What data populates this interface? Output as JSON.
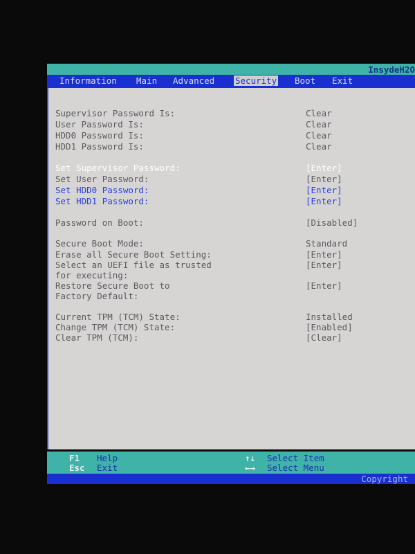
{
  "header": {
    "brand": "InsydeH2O"
  },
  "tabs": [
    {
      "label": "Information"
    },
    {
      "label": "Main"
    },
    {
      "label": "Advanced"
    },
    {
      "label": "Security",
      "active": true
    },
    {
      "label": "Boot"
    },
    {
      "label": "Exit"
    }
  ],
  "settings": [
    {
      "label": "Supervisor Password Is:",
      "value": "Clear",
      "style": "static"
    },
    {
      "label": "User Password Is:",
      "value": "Clear",
      "style": "static"
    },
    {
      "label": "HDD0 Password Is:",
      "value": "Clear",
      "style": "static"
    },
    {
      "label": "HDD1 Password Is:",
      "value": "Clear",
      "style": "static"
    },
    {
      "label": "Set Supervisor Password:",
      "value": "[Enter]",
      "style": "selected"
    },
    {
      "label": "Set User Password:",
      "value": "[Enter]",
      "style": "normal"
    },
    {
      "label": "Set HDD0 Password:",
      "value": "[Enter]",
      "style": "blue"
    },
    {
      "label": "Set HDD1 Password:",
      "value": "[Enter]",
      "style": "blue"
    },
    {
      "label": "Password on Boot:",
      "value": "[Disabled]",
      "style": "normal"
    },
    {
      "label": "Secure Boot Mode:",
      "value": "Standard",
      "style": "static"
    },
    {
      "label": "Erase all Secure Boot Setting:",
      "value": "[Enter]",
      "style": "normal"
    },
    {
      "label": "Select an UEFI file as trusted",
      "label2": "for executing:",
      "value": "[Enter]",
      "style": "normal"
    },
    {
      "label": "Restore Secure Boot to",
      "label2": "Factory Default:",
      "value": "[Enter]",
      "style": "normal"
    },
    {
      "label": "Current TPM (TCM) State:",
      "value": "Installed",
      "style": "static"
    },
    {
      "label": "Change TPM (TCM) State:",
      "value": "[Enabled]",
      "style": "normal"
    },
    {
      "label": "Clear TPM (TCM):",
      "value": "[Clear]",
      "style": "normal"
    }
  ],
  "footer": {
    "f1_key": "F1",
    "f1_label": "Help",
    "esc_key": "Esc",
    "esc_label": "Exit",
    "updown_key": "↑↓",
    "updown_label": "Select Item",
    "leftright_key": "←→",
    "leftright_label": "Select Menu",
    "copyright": "Copyright"
  }
}
